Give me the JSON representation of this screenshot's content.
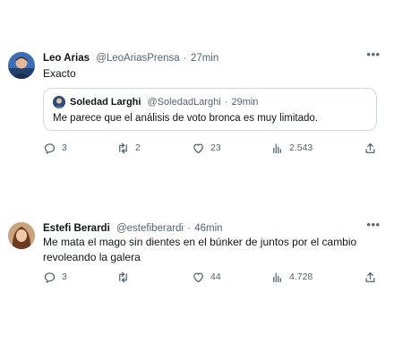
{
  "colors": {
    "text_primary": "#0f1419",
    "text_secondary": "#536471",
    "border": "#cfd9de"
  },
  "tweets": [
    {
      "display_name": "Leo Arias",
      "handle": "@LeoAriasPrensa",
      "separator": "·",
      "time": "27min",
      "text": "Exacto",
      "more_icon": "more-horizontal-icon",
      "quote": {
        "display_name": "Soledad Larghi",
        "handle": "@SoledadLarghi",
        "separator": "·",
        "time": "29min",
        "text": "Me parece que el análisis de voto bronca es muy limitado."
      },
      "actions": {
        "replies": "3",
        "retweets": "2",
        "likes": "23",
        "views": "2.543"
      }
    },
    {
      "display_name": "Estefi Berardi",
      "handle": "@estefiberardi",
      "separator": "·",
      "time": "46min",
      "text": "Me mata el mago sin dientes en el búnker de juntos por el cambio revoleando la galera",
      "more_icon": "more-horizontal-icon",
      "actions": {
        "replies": "3",
        "retweets": "",
        "likes": "44",
        "views": "4.728"
      }
    }
  ]
}
